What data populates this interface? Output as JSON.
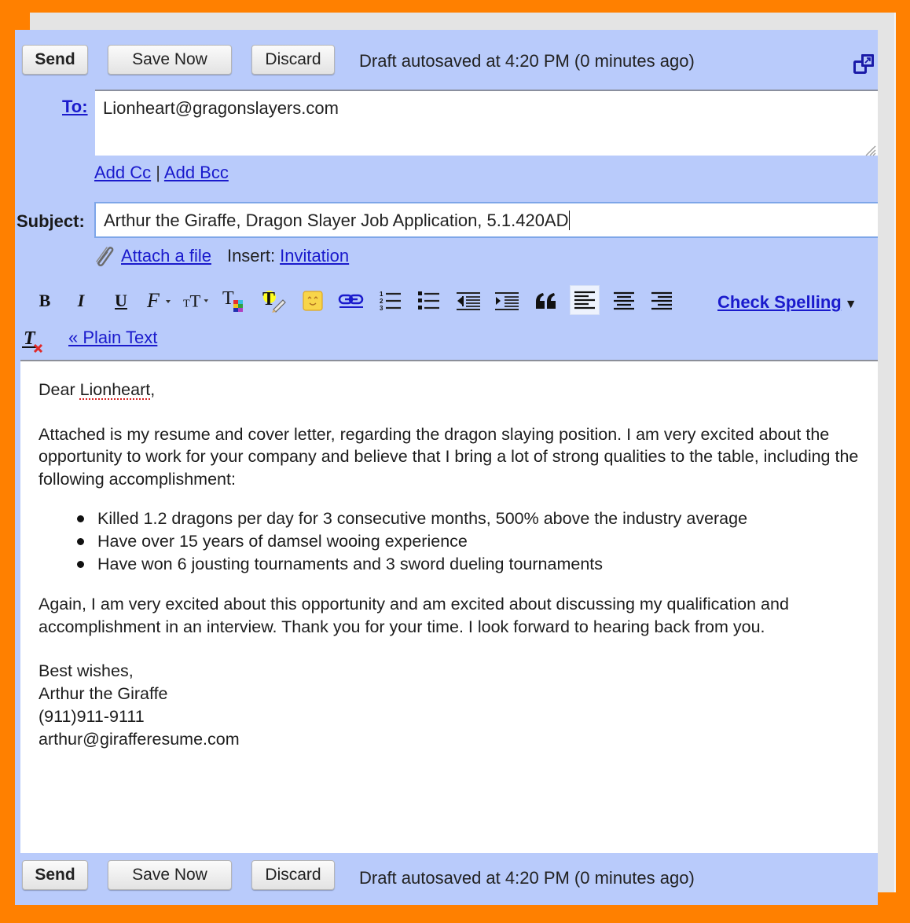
{
  "compose": {
    "buttons": {
      "send": "Send",
      "save_now": "Save Now",
      "discard": "Discard"
    },
    "draft_status": "Draft autosaved at 4:20 PM (0 minutes ago)",
    "popout_icon": "popout-window-icon",
    "to": {
      "label": "To:",
      "value": "Lionheart@gragonslayers.com"
    },
    "add_cc": "Add Cc",
    "separator": "|",
    "add_bcc": "Add Bcc",
    "subject": {
      "label": "Subject:",
      "value": "Arthur the Giraffe, Dragon Slayer Job Application, 5.1.420AD"
    },
    "attach": {
      "icon": "paperclip-icon",
      "label": "Attach a file",
      "insert_label": "Insert:",
      "insert_link": "Invitation"
    },
    "toolbar": {
      "tools": [
        {
          "name": "bold",
          "icon": "bold-icon"
        },
        {
          "name": "italic",
          "icon": "italic-icon"
        },
        {
          "name": "underline",
          "icon": "underline-icon"
        },
        {
          "name": "font",
          "icon": "font-icon"
        },
        {
          "name": "font-size",
          "icon": "font-size-icon"
        },
        {
          "name": "text-color",
          "icon": "text-color-icon"
        },
        {
          "name": "highlight",
          "icon": "highlight-icon"
        },
        {
          "name": "emoticon",
          "icon": "emoticon-icon"
        },
        {
          "name": "link",
          "icon": "link-icon"
        },
        {
          "name": "numbered-list",
          "icon": "numbered-list-icon"
        },
        {
          "name": "bulleted-list",
          "icon": "bulleted-list-icon"
        },
        {
          "name": "indent-less",
          "icon": "indent-less-icon"
        },
        {
          "name": "indent-more",
          "icon": "indent-more-icon"
        },
        {
          "name": "quote",
          "icon": "quote-icon"
        },
        {
          "name": "align-left",
          "icon": "align-left-icon",
          "active": true
        },
        {
          "name": "align-center",
          "icon": "align-center-icon"
        },
        {
          "name": "align-right",
          "icon": "align-right-icon"
        },
        {
          "name": "remove-formatting",
          "icon": "remove-formatting-icon"
        }
      ],
      "check_spelling": "Check Spelling",
      "check_spelling_arrow": "▼",
      "plain_text": "« Plain Text"
    },
    "body": {
      "greeting_prefix": "Dear ",
      "greeting_name": "Lionheart",
      "greeting_suffix": ",",
      "paragraph1": "Attached is my resume and cover letter, regarding the dragon slaying position.  I am very excited about the opportunity to work for your company and believe that I bring a lot of strong qualities to the table, including the following accomplishment:",
      "bullets": [
        "Killed 1.2 dragons per day for 3 consecutive months, 500% above the industry average",
        "Have over 15 years of damsel wooing experience",
        "Have won 6 jousting tournaments and 3 sword dueling tournaments"
      ],
      "paragraph2": "Again, I am very excited about this opportunity and am excited about discussing my qualification and accomplishment in an interview.  Thank you for your time.  I look forward to hearing back from you.",
      "signature": [
        "Best wishes,",
        "Arthur the Giraffe",
        "(911)911-9111",
        "arthur@girafferesume.com"
      ]
    },
    "colors": {
      "frame": "#ff8000",
      "panel": "#b9cbfb",
      "link": "#1a1acc"
    }
  }
}
